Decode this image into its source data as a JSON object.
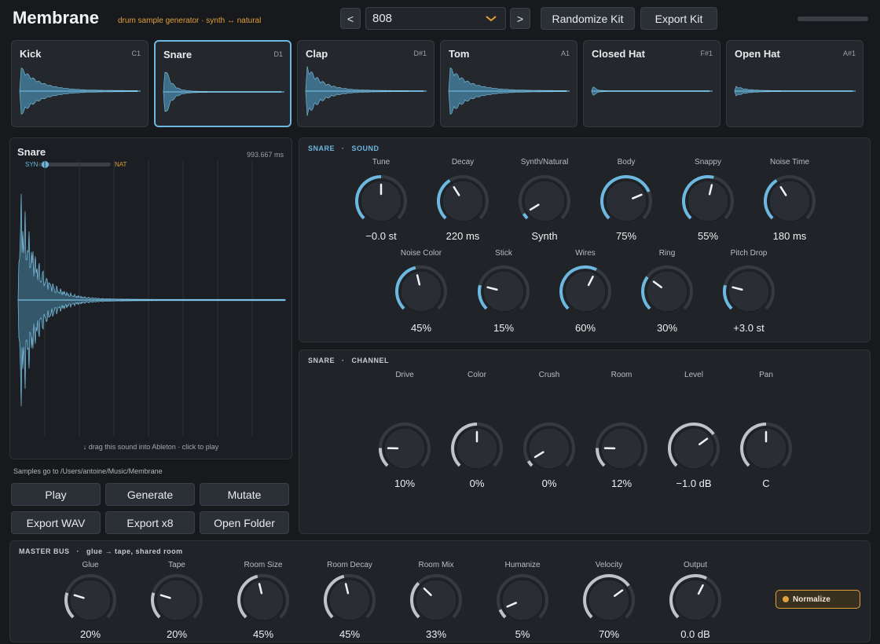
{
  "header": {
    "title": "Membrane",
    "subtitle": "drum sample generator · synth ↔ natural",
    "prev": "<",
    "next": ">",
    "kit": "808",
    "randomize": "Randomize Kit",
    "export_kit": "Export Kit"
  },
  "pads": [
    {
      "name": "Kick",
      "note": "C1",
      "selected": false
    },
    {
      "name": "Snare",
      "note": "D1",
      "selected": true
    },
    {
      "name": "Clap",
      "note": "D#1",
      "selected": false
    },
    {
      "name": "Tom",
      "note": "A1",
      "selected": false
    },
    {
      "name": "Closed Hat",
      "note": "F#1",
      "selected": false
    },
    {
      "name": "Open Hat",
      "note": "A#1",
      "selected": false
    }
  ],
  "waveform": {
    "title": "Snare",
    "duration": "993.667 ms",
    "syn": "SYN",
    "nat": "NAT",
    "blend": 0.05,
    "hint": "↓ drag this sound into Ableton · click to play"
  },
  "samples_path": "Samples go to /Users/antoine/Music/Membrane",
  "buttons": {
    "play": "Play",
    "generate": "Generate",
    "mutate": "Mutate",
    "export_wav": "Export WAV",
    "export_x8": "Export x8",
    "open_folder": "Open Folder"
  },
  "sound": {
    "inst": "SNARE",
    "sep": "·",
    "title": "SOUND",
    "knobs": [
      {
        "label": "Tune",
        "value": "−0.0 st",
        "level": 0.5
      },
      {
        "label": "Decay",
        "value": "220 ms",
        "level": 0.38
      },
      {
        "label": "Synth/Natural",
        "value": "Synth",
        "level": 0.05
      },
      {
        "label": "Body",
        "value": "75%",
        "level": 0.75
      },
      {
        "label": "Snappy",
        "value": "55%",
        "level": 0.55
      },
      {
        "label": "Noise Time",
        "value": "180 ms",
        "level": 0.38
      },
      {
        "label": "Noise Color",
        "value": "45%",
        "level": 0.45
      },
      {
        "label": "Stick",
        "value": "15%",
        "level": 0.22
      },
      {
        "label": "Wires",
        "value": "60%",
        "level": 0.6
      },
      {
        "label": "Ring",
        "value": "30%",
        "level": 0.3
      },
      {
        "label": "Pitch Drop",
        "value": "+3.0 st",
        "level": 0.22
      }
    ]
  },
  "channel": {
    "inst": "SNARE",
    "sep": "·",
    "title": "CHANNEL",
    "knobs": [
      {
        "label": "Drive",
        "value": "10%",
        "level": 0.17
      },
      {
        "label": "Color",
        "value": "0%",
        "level": 0.5
      },
      {
        "label": "Crush",
        "value": "0%",
        "level": 0.05
      },
      {
        "label": "Room",
        "value": "12%",
        "level": 0.17
      },
      {
        "label": "Level",
        "value": "−1.0 dB",
        "level": 0.7
      },
      {
        "label": "Pan",
        "value": "C",
        "level": 0.5
      }
    ]
  },
  "master": {
    "title": "MASTER BUS",
    "sep": "·",
    "subtitle": "glue → tape, shared room",
    "knobs": [
      {
        "label": "Glue",
        "value": "20%",
        "level": 0.23
      },
      {
        "label": "Tape",
        "value": "20%",
        "level": 0.23
      },
      {
        "label": "Room Size",
        "value": "45%",
        "level": 0.45
      },
      {
        "label": "Room Decay",
        "value": "45%",
        "level": 0.45
      },
      {
        "label": "Room Mix",
        "value": "33%",
        "level": 0.33
      },
      {
        "label": "Humanize",
        "value": "5%",
        "level": 0.08
      },
      {
        "label": "Velocity",
        "value": "70%",
        "level": 0.7
      },
      {
        "label": "Output",
        "value": "0.0 dB",
        "level": 0.6
      }
    ],
    "normalize": "Normalize"
  },
  "colors": {
    "accent": "#6cb8e0",
    "orange": "#e0a13a",
    "master_arc": "#bfc3c8",
    "panel": "#202328"
  }
}
